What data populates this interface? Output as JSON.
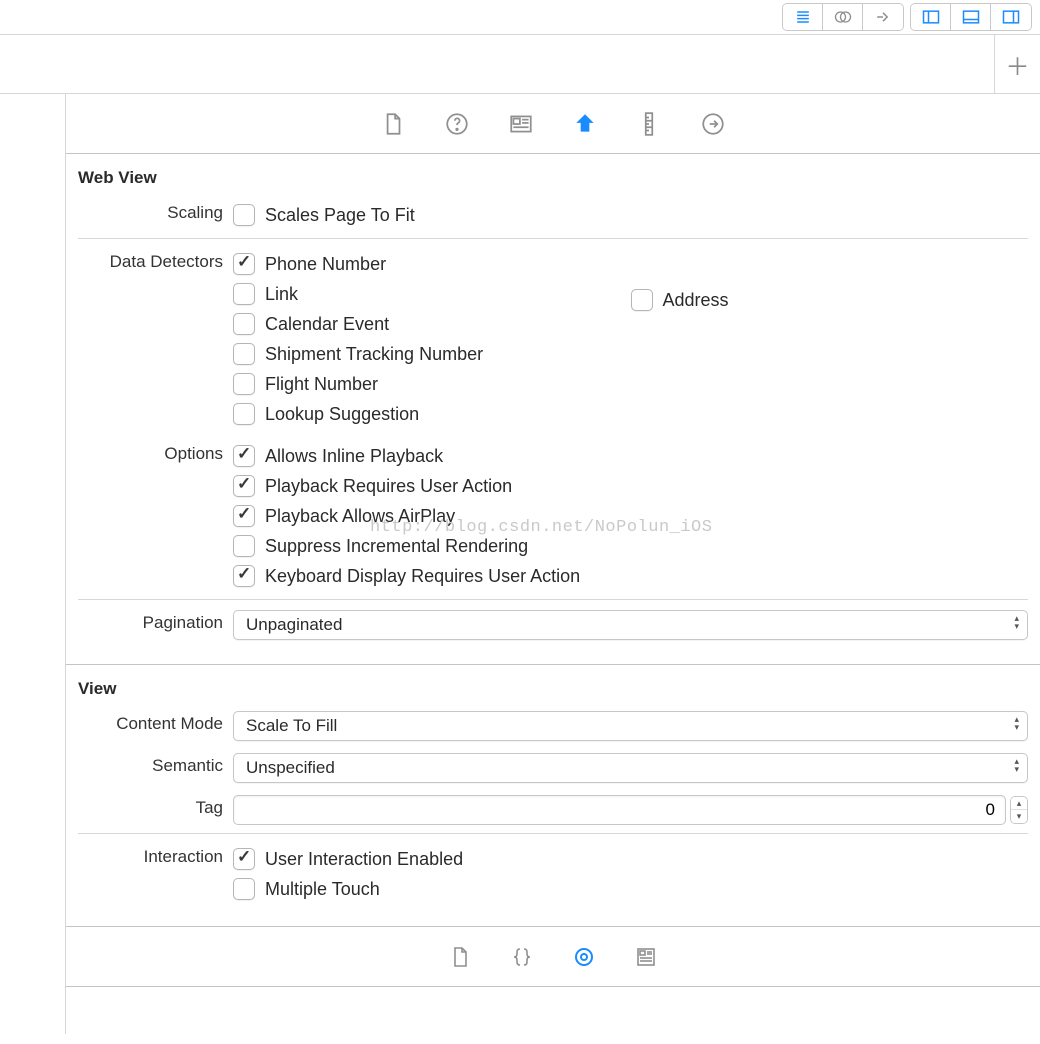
{
  "watermark": "http://blog.csdn.net/NoPolun_iOS",
  "webview": {
    "header": "Web View",
    "scaling": {
      "label": "Scaling",
      "opt": {
        "label": "Scales Page To Fit",
        "checked": false
      }
    },
    "dataDetectors": {
      "label": "Data Detectors",
      "leftCol": [
        {
          "label": "Phone Number",
          "checked": true
        },
        {
          "label": "Link",
          "checked": false
        },
        {
          "label": "Calendar Event",
          "checked": false
        },
        {
          "label": "Shipment Tracking Number",
          "checked": false
        },
        {
          "label": "Flight Number",
          "checked": false
        },
        {
          "label": "Lookup Suggestion",
          "checked": false
        }
      ],
      "rightCol": [
        {
          "label": "Address",
          "checked": false
        }
      ]
    },
    "options": {
      "label": "Options",
      "items": [
        {
          "label": "Allows Inline Playback",
          "checked": true
        },
        {
          "label": "Playback Requires User Action",
          "checked": true
        },
        {
          "label": "Playback Allows AirPlay",
          "checked": true
        },
        {
          "label": "Suppress Incremental Rendering",
          "checked": false
        },
        {
          "label": "Keyboard Display Requires User Action",
          "checked": true
        }
      ]
    },
    "pagination": {
      "label": "Pagination",
      "value": "Unpaginated"
    }
  },
  "view": {
    "header": "View",
    "contentMode": {
      "label": "Content Mode",
      "value": "Scale To Fill"
    },
    "semantic": {
      "label": "Semantic",
      "value": "Unspecified"
    },
    "tag": {
      "label": "Tag",
      "value": "0"
    },
    "interaction": {
      "label": "Interaction",
      "items": [
        {
          "label": "User Interaction Enabled",
          "checked": true
        },
        {
          "label": "Multiple Touch",
          "checked": false
        }
      ]
    }
  }
}
